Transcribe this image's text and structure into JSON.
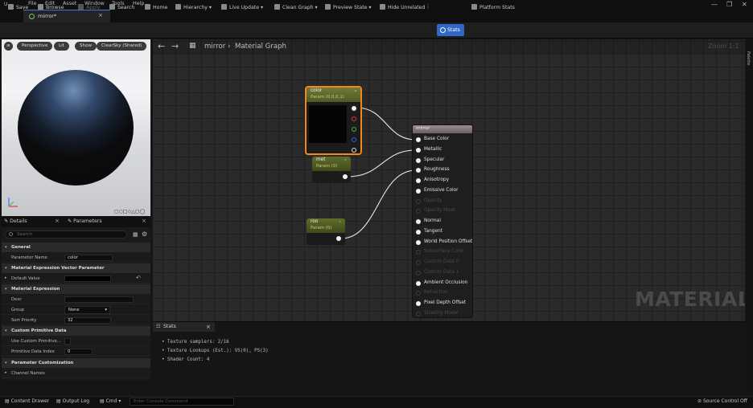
{
  "menu": {
    "items": [
      "File",
      "Edit",
      "Asset",
      "Window",
      "Tools",
      "Help"
    ],
    "logo": "U"
  },
  "window_controls": [
    "—",
    "❐",
    "✕"
  ],
  "doc_tab": {
    "label": "mirror*",
    "close": "×"
  },
  "toolbar": {
    "save": "Save",
    "browse": "Browse",
    "apply": "Apply",
    "search": "Search",
    "home": "Home",
    "hierarchy": "Hierarchy",
    "live_update": "Live Update",
    "clean_graph": "Clean Graph",
    "preview_state": "Preview State",
    "hide_unrelated": "Hide Unrelated",
    "stats": "Stats",
    "platform_stats": "Platform Stats"
  },
  "viewport": {
    "perspective": "Perspective",
    "lit": "Lit",
    "show": "Show",
    "sky": "ClearSky (Shared)"
  },
  "details_panel": {
    "tab_details": "Details",
    "tab_parameters": "Parameters",
    "search_placeholder": "Search",
    "sections": {
      "general": "General",
      "vector_param": "Material Expression Vector Parameter",
      "material_expression": "Material Expression",
      "custom_primitive": "Custom Primitive Data",
      "param_customization": "Parameter Customization",
      "channel_names": "Channel Names"
    },
    "rows": {
      "parameter_name_label": "Parameter Name",
      "parameter_name_value": "color",
      "default_value_label": "Default Value",
      "desc_label": "Desc",
      "group_label": "Group",
      "group_value": "None",
      "sort_priority_label": "Sort Priority",
      "sort_priority_value": "32",
      "use_custom_primitive_label": "Use Custom Primitive...",
      "primitive_data_index_label": "Primitive Data Index",
      "primitive_data_index_value": "0"
    }
  },
  "graph": {
    "breadcrumb_asset": "mirror",
    "breadcrumb_sep": "›",
    "breadcrumb_graph": "Material Graph",
    "zoom": "Zoom 1:1",
    "watermark": "MATERIAL",
    "palette": "Palette"
  },
  "nodes": {
    "color": {
      "title": "color",
      "subtitle": "Param (0,0,0,1)"
    },
    "metal": {
      "title": "met",
      "subtitle": "Param (0)"
    },
    "roughness": {
      "title": "roo",
      "subtitle": "Param (0)"
    },
    "main": {
      "title": "mirror",
      "pins": [
        {
          "label": "Base Color",
          "enabled": true
        },
        {
          "label": "Metallic",
          "enabled": true
        },
        {
          "label": "Specular",
          "enabled": true
        },
        {
          "label": "Roughness",
          "enabled": true
        },
        {
          "label": "Anisotropy",
          "enabled": true
        },
        {
          "label": "Emissive Color",
          "enabled": true
        },
        {
          "label": "Opacity",
          "enabled": false
        },
        {
          "label": "Opacity Mask",
          "enabled": false
        },
        {
          "label": "Normal",
          "enabled": true
        },
        {
          "label": "Tangent",
          "enabled": true
        },
        {
          "label": "World Position Offset",
          "enabled": true
        },
        {
          "label": "Subsurface Color",
          "enabled": false
        },
        {
          "label": "Custom Data 0",
          "enabled": false
        },
        {
          "label": "Custom Data 1",
          "enabled": false
        },
        {
          "label": "Ambient Occlusion",
          "enabled": true
        },
        {
          "label": "Refraction",
          "enabled": false
        },
        {
          "label": "Pixel Depth Offset",
          "enabled": true
        },
        {
          "label": "Shading Model",
          "enabled": false
        }
      ]
    }
  },
  "stats_panel": {
    "tab": "Stats",
    "lines": [
      "• Texture samplers: 2/16",
      "• Texture Lookups (Est.): VS(0), PS(3)",
      "• Shader Count: 4"
    ]
  },
  "statusbar": {
    "content_drawer": "Content Drawer",
    "output_log": "Output Log",
    "cmd": "Cmd",
    "console_placeholder": "Enter Console Command",
    "source_control": "Source Control Off"
  },
  "colors": {
    "accent": "#2f68c7",
    "selection": "#f08a12",
    "param_header": "#5f6c2b"
  }
}
